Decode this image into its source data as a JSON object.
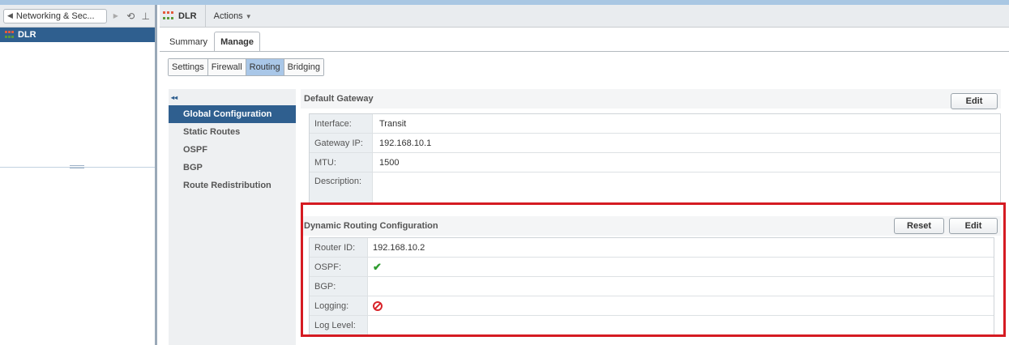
{
  "nav": {
    "back_label": "Networking & Sec...",
    "history_icon": "history-icon",
    "pin_icon": "pin-icon"
  },
  "tree": {
    "items": [
      {
        "label": "DLR"
      }
    ]
  },
  "object": {
    "title": "DLR",
    "actions_label": "Actions"
  },
  "tabs": [
    {
      "label": "Summary"
    },
    {
      "label": "Manage"
    }
  ],
  "subtabs": [
    {
      "label": "Settings"
    },
    {
      "label": "Firewall"
    },
    {
      "label": "Routing"
    },
    {
      "label": "Bridging"
    }
  ],
  "side_menu": {
    "collapse_glyph": "◂◂",
    "items": [
      {
        "label": "Global Configuration"
      },
      {
        "label": "Static Routes"
      },
      {
        "label": "OSPF"
      },
      {
        "label": "BGP"
      },
      {
        "label": "Route Redistribution"
      }
    ]
  },
  "default_gateway": {
    "title": "Default Gateway",
    "edit_label": "Edit",
    "rows": [
      {
        "label": "Interface:",
        "value": "Transit"
      },
      {
        "label": "Gateway IP:",
        "value": "192.168.10.1"
      },
      {
        "label": "MTU:",
        "value": "1500"
      },
      {
        "label": "Description:",
        "value": ""
      }
    ]
  },
  "dynamic_routing": {
    "title": "Dynamic Routing Configuration",
    "reset_label": "Reset",
    "edit_label": "Edit",
    "rows": [
      {
        "label": "Router ID:",
        "value": "192.168.10.2"
      },
      {
        "label": "OSPF:",
        "value": "✔",
        "icon": "check-icon"
      },
      {
        "label": "BGP:",
        "value": ""
      },
      {
        "label": "Logging:",
        "value": "",
        "icon": "disabled-icon"
      },
      {
        "label": "Log Level:",
        "value": ""
      }
    ]
  },
  "colors": {
    "selected_bg": "#2f5f8f",
    "highlight_border": "#d51b22",
    "active_subtab": "#a9c7e8"
  }
}
